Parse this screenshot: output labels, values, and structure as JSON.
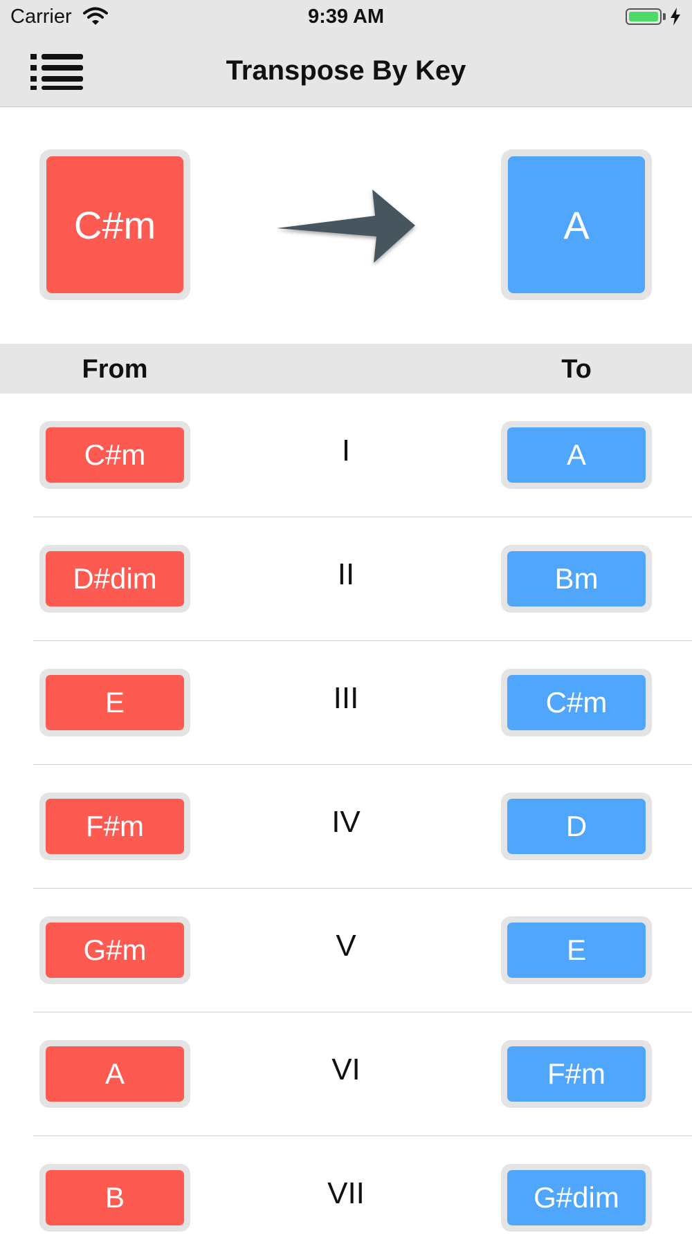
{
  "status_bar": {
    "carrier": "Carrier",
    "time": "9:39 AM"
  },
  "nav": {
    "title": "Transpose By Key"
  },
  "keys": {
    "from": "C#m",
    "to": "A"
  },
  "table": {
    "from_header": "From",
    "to_header": "To",
    "rows": [
      {
        "from": "C#m",
        "degree": "I",
        "to": "A"
      },
      {
        "from": "D#dim",
        "degree": "II",
        "to": "Bm"
      },
      {
        "from": "E",
        "degree": "III",
        "to": "C#m"
      },
      {
        "from": "F#m",
        "degree": "IV",
        "to": "D"
      },
      {
        "from": "G#m",
        "degree": "V",
        "to": "E"
      },
      {
        "from": "A",
        "degree": "VI",
        "to": "F#m"
      },
      {
        "from": "B",
        "degree": "VII",
        "to": "G#dim"
      }
    ]
  },
  "colors": {
    "from_accent": "#fd5b52",
    "to_accent": "#4fa6fb",
    "bar_background": "#e6e6e6"
  },
  "icons": {
    "menu": "list-menu-icon",
    "transpose": "arrow-right-icon",
    "wifi": "wifi-icon",
    "battery": "battery-icon",
    "charging": "charging-bolt-icon"
  }
}
